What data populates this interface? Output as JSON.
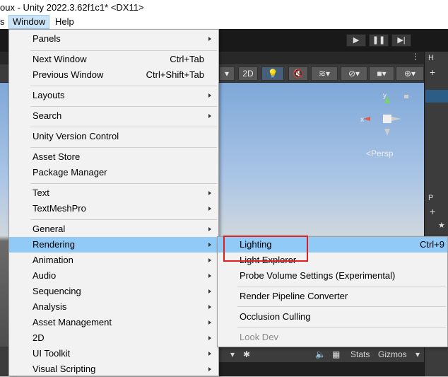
{
  "window": {
    "title": "oux - Unity 2022.3.62f1c1* <DX11>"
  },
  "menubar": {
    "partial_item": "s",
    "window_label": "Window",
    "help_label": "Help"
  },
  "editor": {
    "scene_toolbar": {
      "mode_2d": "2D"
    },
    "scene_view": {
      "projection_label": "Persp",
      "gizmo_labels": {
        "x": "x",
        "y": "y"
      }
    },
    "hierarchy_tab_label": "H",
    "project_tab_label": "P",
    "bottom_toolbar": {
      "stats_label": "Stats",
      "gizmos_label": "Gizmos"
    }
  },
  "window_menu": {
    "items": [
      {
        "label": "Panels",
        "submenu": true
      },
      {
        "label": "Next Window",
        "shortcut": "Ctrl+Tab"
      },
      {
        "label": "Previous Window",
        "shortcut": "Ctrl+Shift+Tab"
      },
      {
        "label": "Layouts",
        "submenu": true
      },
      {
        "label": "Search",
        "submenu": true
      },
      {
        "label": "Unity Version Control"
      },
      {
        "label": "Asset Store"
      },
      {
        "label": "Package Manager"
      },
      {
        "label": "Text",
        "submenu": true
      },
      {
        "label": "TextMeshPro",
        "submenu": true
      },
      {
        "label": "General",
        "submenu": true
      },
      {
        "label": "Rendering",
        "submenu": true,
        "active": true
      },
      {
        "label": "Animation",
        "submenu": true
      },
      {
        "label": "Audio",
        "submenu": true
      },
      {
        "label": "Sequencing",
        "submenu": true
      },
      {
        "label": "Analysis",
        "submenu": true
      },
      {
        "label": "Asset Management",
        "submenu": true
      },
      {
        "label": "2D",
        "submenu": true
      },
      {
        "label": "UI Toolkit",
        "submenu": true
      },
      {
        "label": "Visual Scripting",
        "submenu": true
      }
    ]
  },
  "rendering_submenu": {
    "items": [
      {
        "label": "Lighting",
        "shortcut": "Ctrl+9",
        "active": true
      },
      {
        "label": "Light Explorer"
      },
      {
        "label": "Probe Volume Settings (Experimental)"
      },
      {
        "label": "Render Pipeline Converter"
      },
      {
        "label": "Occlusion Culling"
      },
      {
        "label": "Look Dev",
        "disabled": true
      }
    ]
  },
  "colors": {
    "menu_highlight": "#91c9f7",
    "annotation_box": "#e02020",
    "editor_dark": "#3c3c3c"
  }
}
